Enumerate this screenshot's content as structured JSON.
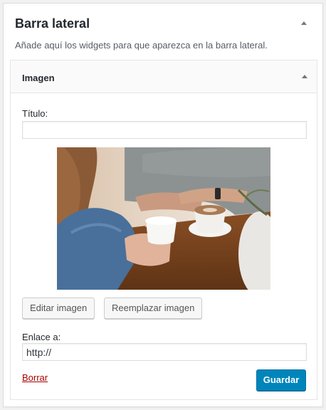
{
  "panel": {
    "title": "Barra lateral",
    "description": "Añade aquí los widgets para que aparezca en la barra lateral."
  },
  "widget": {
    "title": "Imagen",
    "title_field_label": "Título:",
    "title_field_value": "",
    "image_alt": "Dos personas con tazas de café sobre una mesa de madera",
    "edit_image_label": "Editar imagen",
    "replace_image_label": "Reemplazar imagen",
    "link_label": "Enlace a:",
    "link_value": "http://",
    "delete_label": "Borrar",
    "save_label": "Guardar"
  },
  "colors": {
    "primary": "#0085ba",
    "delete": "#aa0000",
    "background": "#f1f1f1"
  }
}
